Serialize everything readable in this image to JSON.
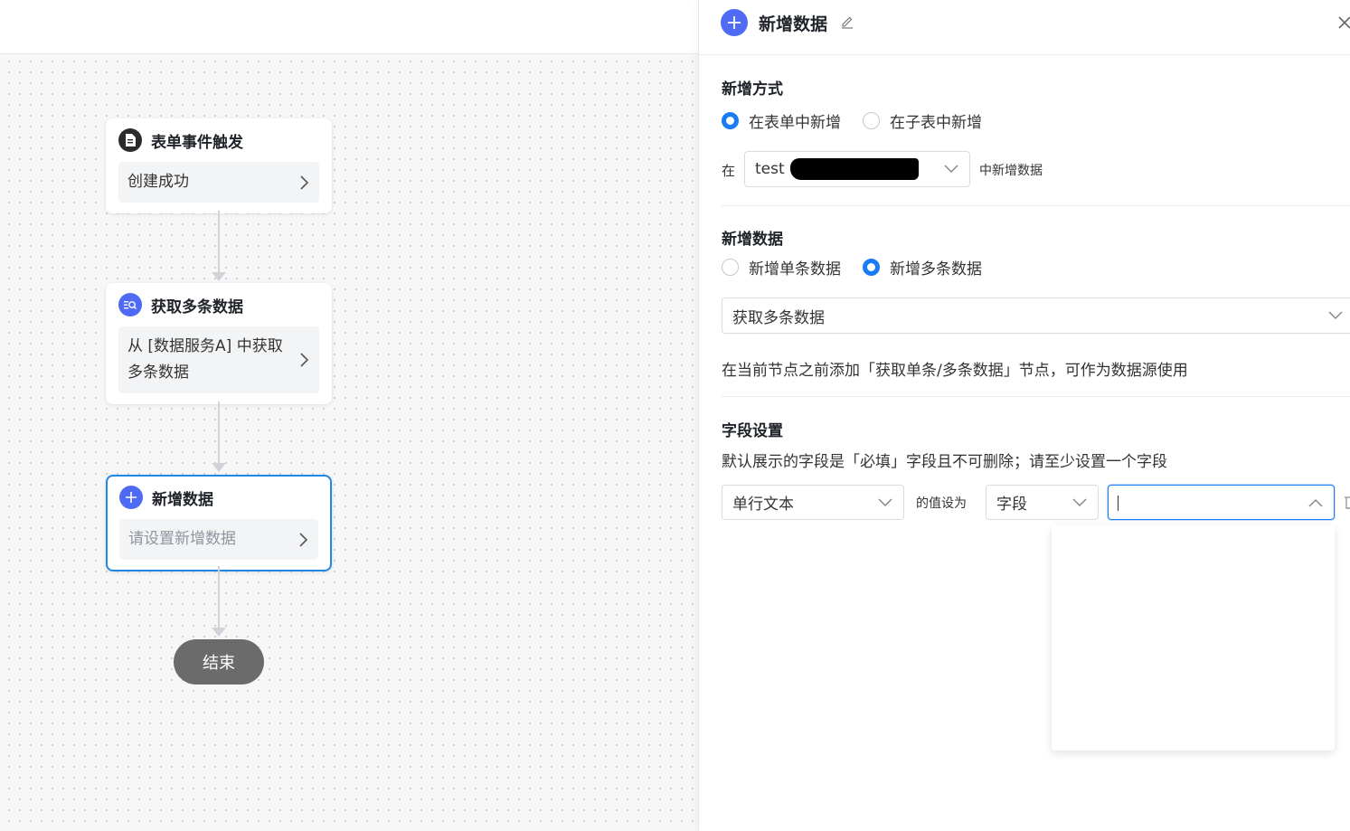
{
  "flow": {
    "nodes": [
      {
        "title": "表单事件触发",
        "body": "创建成功",
        "icon": "document-icon"
      },
      {
        "title": "获取多条数据",
        "body": "从 [数据服务A] 中获取多条数据",
        "icon": "data-search-icon"
      },
      {
        "title": "新增数据",
        "body_placeholder": "请设置新增数据",
        "icon": "plus-icon"
      }
    ],
    "end_label": "结束"
  },
  "panel": {
    "title": "新增数据",
    "mode": {
      "label": "新增方式",
      "options": [
        "在表单中新增",
        "在子表中新增"
      ],
      "selected": 0,
      "prefix": "在",
      "form_select_value": "test",
      "suffix": "中新增数据"
    },
    "add_data": {
      "label": "新增数据",
      "options": [
        "新增单条数据",
        "新增多条数据"
      ],
      "selected": 1,
      "source_value": "获取多条数据",
      "hint": "在当前节点之前添加「获取单条/多条数据」节点，可作为数据源使用"
    },
    "fields": {
      "label": "字段设置",
      "hint": "默认展示的字段是「必填」字段且不可删除；请至少设置一个字段",
      "field_type": "单行文本",
      "value_label": "的值设为",
      "value_type": "字段"
    }
  },
  "colors": {
    "primary": "#1a7cf5",
    "node_icon_blue": "#4f6bf6",
    "end_node": "#6b6b6b"
  }
}
